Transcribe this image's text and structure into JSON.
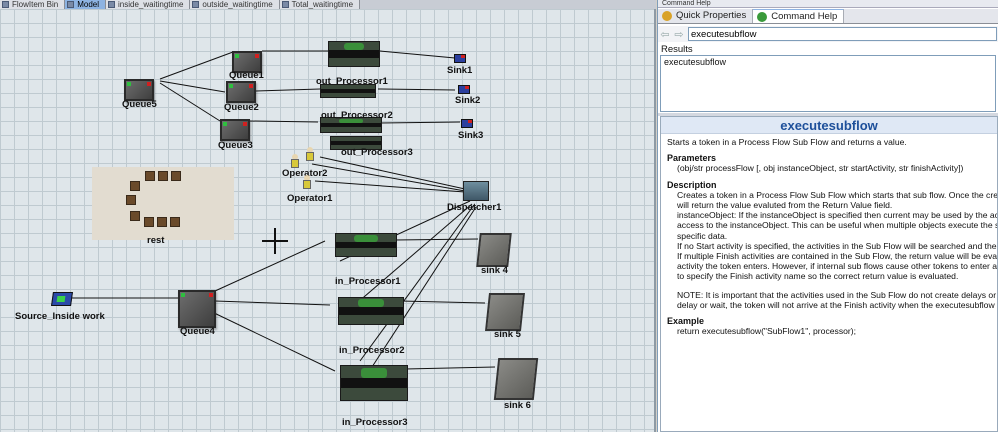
{
  "tabs": [
    {
      "label": "FlowItem Bin",
      "active": false
    },
    {
      "label": "Model",
      "active": true
    },
    {
      "label": "inside_waitingtime",
      "active": false
    },
    {
      "label": "outside_waitingtime",
      "active": false
    },
    {
      "label": "Total_waitingtime",
      "active": false
    }
  ],
  "model": {
    "queues": [
      "Queue1",
      "Queue2",
      "Queue3",
      "Queue4",
      "Queue5"
    ],
    "out_processors": [
      "out_Processor1",
      "out_Processor2",
      "out_Processor3"
    ],
    "in_processors": [
      "in_Processor1",
      "in_Processor2",
      "in_Processor3"
    ],
    "sinks_top": [
      "Sink1",
      "Sink2",
      "Sink3"
    ],
    "sinks_bottom": [
      "sink 4",
      "sink 5",
      "sink 6"
    ],
    "operators": [
      "Operator2",
      "Operator1"
    ],
    "dispatcher": "Dispatcher1",
    "rest_area": "rest",
    "source": "Source_Inside work"
  },
  "panel": {
    "title": "Command Help",
    "tabs": [
      {
        "label": "Quick Properties",
        "icon": "gear-icon",
        "active": false
      },
      {
        "label": "Command Help",
        "icon": "help-icon",
        "active": true
      }
    ],
    "search_value": "executesubflow",
    "results_label": "Results",
    "results": [
      "executesubflow"
    ],
    "doc": {
      "title": "executesubflow",
      "summary": "Starts a token in a Process Flow Sub Flow and returns a value.",
      "parameters_heading": "Parameters",
      "parameters": "(obj/str processFlow [, obj instanceObject, str startActivity, str finishActivity])",
      "description_heading": "Description",
      "description_lines": [
        "Creates a token in a Process Flow Sub Flow which starts that sub flow. Once the created",
        "will return the value evaluted from the Return Value field.",
        "instanceObject: If the instanceObject is specified then current may be used by the activitie",
        "access to the instanceObject. This can be useful when multiple objects execute the same",
        "specific data.",
        "If no Start activity is specified, the activities in the Sub Flow will be searched and the first S",
        "If multiple Finish activities are contained in the Sub Flow, the return value will be evaluated",
        "activity the token enters. However, if internal sub flows cause other tokens to enter a Finis",
        "to specify the Finish activity name so the correct return value is evaluated."
      ],
      "note_lines": [
        "NOTE: It is important that the activities used in the Sub Flow do not create delays or wait. I",
        "delay or wait, the token will not arrive at the Finish activity when the executesubflow functio"
      ],
      "example_heading": "Example",
      "example": "return executesubflow(\"SubFlow1\", processor);"
    }
  }
}
